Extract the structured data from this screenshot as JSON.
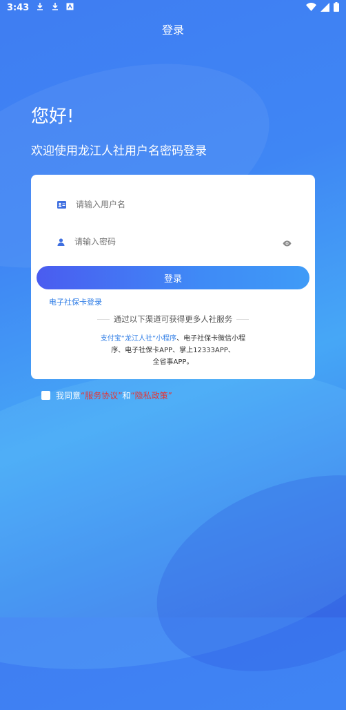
{
  "status_bar": {
    "time": "3:43"
  },
  "nav": {
    "title": "登录"
  },
  "hero": {
    "greeting": "您好!",
    "welcome": "欢迎使用龙江人社用户名密码登录"
  },
  "form": {
    "username_placeholder": "请输入用户名",
    "password_placeholder": "请输入密码",
    "login_label": "登录",
    "ecard_login": "电子社保卡登录",
    "divider_text": "通过以下渠道可获得更多人社服务",
    "channels_line1_blue": "支付宝“龙江人社”小程序",
    "channels_line1_rest": "、电子社保卡微信小程",
    "channels_line2": "序、电子社保卡APP、掌上12333APP、",
    "channels_line3": "全省事APP。"
  },
  "agreement": {
    "prefix": "我同意",
    "service": "“服务协议”",
    "and": "和",
    "privacy": "“隐私政策”"
  },
  "colors": {
    "accent": "#3f86f4",
    "link": "#2f7de6",
    "policy": "#e43535"
  }
}
